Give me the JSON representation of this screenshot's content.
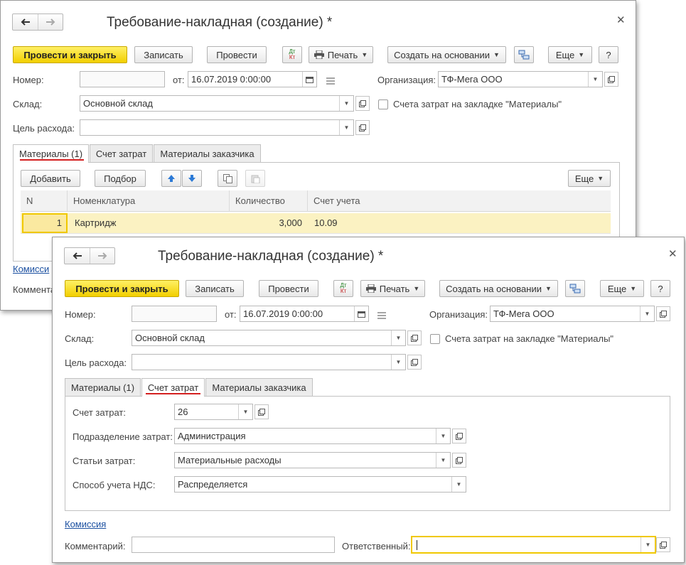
{
  "window_back": {
    "title": "Требование-накладная (создание) *",
    "toolbar": {
      "post_close": "Провести и закрыть",
      "save": "Записать",
      "post": "Провести",
      "dt": "Дт",
      "kt": "Кт",
      "print": "Печать",
      "create_based": "Создать на основании",
      "more": "Еще",
      "help": "?"
    },
    "fields": {
      "number_label": "Номер:",
      "number_value": "",
      "date_from_label": "от:",
      "date_value": "16.07.2019  0:00:00",
      "org_label": "Организация:",
      "org_value": "ТФ-Мега ООО",
      "warehouse_label": "Склад:",
      "warehouse_value": "Основной склад",
      "purpose_label": "Цель расхода:",
      "purpose_value": "",
      "cost_accounts_checkbox": "Счета затрат на закладке \"Материалы\""
    },
    "tabs": [
      "Материалы (1)",
      "Счет затрат",
      "Материалы заказчика"
    ],
    "active_tab": 0,
    "table_toolbar": {
      "add": "Добавить",
      "select": "Подбор",
      "more": "Еще"
    },
    "table": {
      "columns": [
        "N",
        "Номенклатура",
        "Количество",
        "Счет учета"
      ],
      "rows": [
        {
          "n": "1",
          "item": "Картридж",
          "qty": "3,000",
          "account": "10.09"
        }
      ]
    },
    "footer": {
      "commission_link": "Комисси",
      "comment_label": "Коммента"
    }
  },
  "window_front": {
    "title": "Требование-накладная (создание) *",
    "toolbar": {
      "post_close": "Провести и закрыть",
      "save": "Записать",
      "post": "Провести",
      "dt": "Дт",
      "kt": "Кт",
      "print": "Печать",
      "create_based": "Создать на основании",
      "more": "Еще",
      "help": "?"
    },
    "fields": {
      "number_label": "Номер:",
      "number_value": "",
      "date_from_label": "от:",
      "date_value": "16.07.2019  0:00:00",
      "org_label": "Организация:",
      "org_value": "ТФ-Мега ООО",
      "warehouse_label": "Склад:",
      "warehouse_value": "Основной склад",
      "purpose_label": "Цель расхода:",
      "purpose_value": "",
      "cost_accounts_checkbox": "Счета затрат на закладке \"Материалы\""
    },
    "tabs": [
      "Материалы (1)",
      "Счет затрат",
      "Материалы заказчика"
    ],
    "active_tab": 1,
    "cost_tab": {
      "account_label": "Счет затрат:",
      "account_value": "26",
      "division_label": "Подразделение затрат:",
      "division_value": "Администрация",
      "articles_label": "Статьи затрат:",
      "articles_value": "Материальные расходы",
      "vat_label": "Способ учета НДС:",
      "vat_value": "Распределяется"
    },
    "footer": {
      "commission_link": "Комиссия",
      "comment_label": "Комментарий:",
      "comment_value": "",
      "responsible_label": "Ответственный:",
      "responsible_value": ""
    }
  },
  "colors": {
    "primary_button": "#f5d400",
    "active_row": "#fbf2c2",
    "tab_underline": "#d42020",
    "link": "#1a4fa0",
    "focus_border": "#f0c800"
  }
}
